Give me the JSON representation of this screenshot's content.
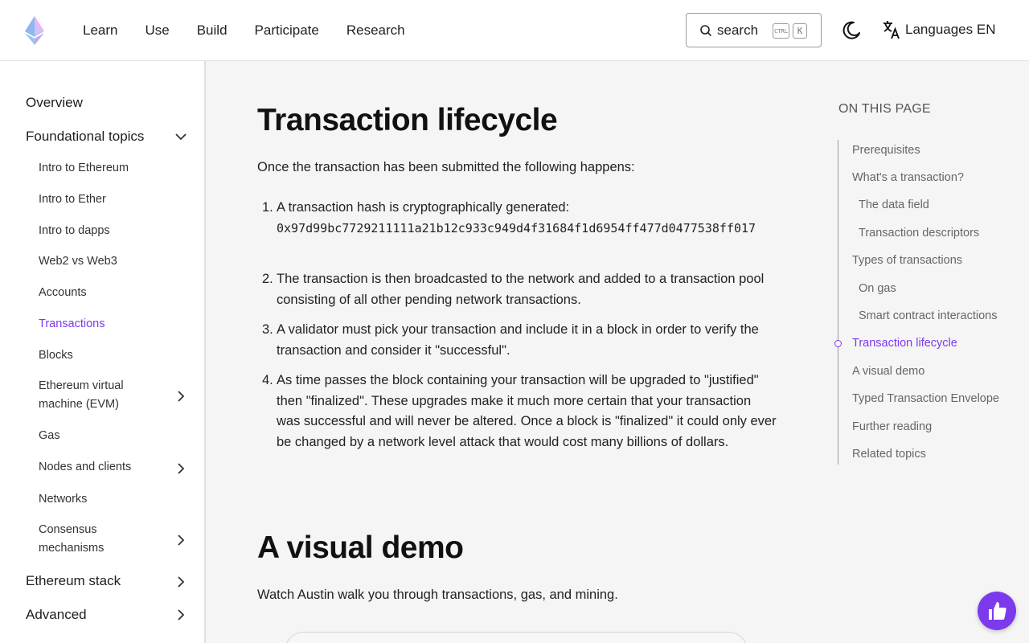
{
  "header": {
    "nav": [
      "Learn",
      "Use",
      "Build",
      "Participate",
      "Research"
    ],
    "search_label": "search",
    "kbd_ctrl": "CTRL",
    "kbd_k": "K",
    "lang_label": "Languages EN"
  },
  "sidebar": {
    "overview": "Overview",
    "foundational": "Foundational topics",
    "items": [
      "Intro to Ethereum",
      "Intro to Ether",
      "Intro to dapps",
      "Web2 vs Web3",
      "Accounts",
      "Transactions",
      "Blocks",
      "Ethereum virtual machine (EVM)",
      "Gas",
      "Nodes and clients",
      "Networks",
      "Consensus mechanisms"
    ],
    "ethereum_stack": "Ethereum stack",
    "advanced": "Advanced"
  },
  "main": {
    "h1": "Transaction lifecycle",
    "intro": "Once the transaction has been submitted the following happens:",
    "steps": [
      {
        "num": "1.",
        "text": "A transaction hash is cryptographically generated:",
        "code": "0x97d99bc7729211111a21b12c933c949d4f31684f1d6954ff477d0477538ff017"
      },
      {
        "num": "2.",
        "text": "The transaction is then broadcasted to the network and added to a transaction pool consisting of all other pending network transactions."
      },
      {
        "num": "3.",
        "text": "A validator must pick your transaction and include it in a block in order to verify the transaction and consider it \"successful\"."
      },
      {
        "num": "4.",
        "text": "As time passes the block containing your transaction will be upgraded to \"justified\" then \"finalized\". These upgrades make it much more certain that your transaction was successful and will never be altered. Once a block is \"finalized\" it could only ever be changed by a network level attack that would cost many billions of dollars."
      }
    ],
    "h2": "A visual demo",
    "demo_text": "Watch Austin walk you through transactions, gas, and mining."
  },
  "toc": {
    "title": "ON THIS PAGE",
    "items": [
      "Prerequisites",
      "What's a transaction?",
      "The data field",
      "Transaction descriptors",
      "Types of transactions",
      "On gas",
      "Smart contract interactions",
      "Transaction lifecycle",
      "A visual demo",
      "Typed Transaction Envelope",
      "Further reading",
      "Related topics"
    ]
  },
  "colors": {
    "accent": "#7c3aed",
    "main_bg": "#f5f5f5"
  }
}
